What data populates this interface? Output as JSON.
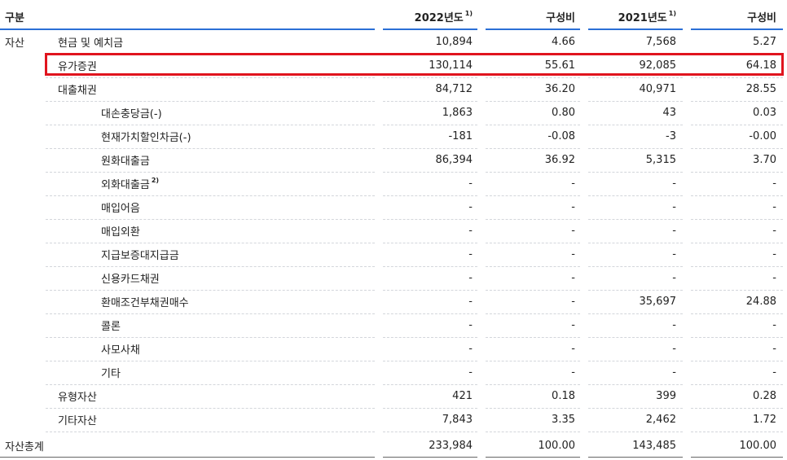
{
  "header": {
    "category": "구분",
    "y2022": "2022년도",
    "y2022_sup": "1)",
    "ratio1": "구성비",
    "y2021": "2021년도",
    "y2021_sup": "1)",
    "ratio2": "구성비"
  },
  "asset_category": "자산",
  "rows": [
    {
      "label": "현금 및 예치금",
      "sup": "",
      "v2022": "10,894",
      "r2022": "4.66",
      "v2021": "7,568",
      "r2021": "5.27"
    },
    {
      "label": "유가증권",
      "sup": "",
      "v2022": "130,114",
      "r2022": "55.61",
      "v2021": "92,085",
      "r2021": "64.18"
    },
    {
      "label": "대출채권",
      "sup": "",
      "v2022": "84,712",
      "r2022": "36.20",
      "v2021": "40,971",
      "r2021": "28.55"
    },
    {
      "label": "대손충당금(-)",
      "sup": "",
      "v2022": "1,863",
      "r2022": "0.80",
      "v2021": "43",
      "r2021": "0.03"
    },
    {
      "label": "현재가치할인차금(-)",
      "sup": "",
      "v2022": "-181",
      "r2022": "-0.08",
      "v2021": "-3",
      "r2021": "-0.00"
    },
    {
      "label": "원화대출금",
      "sup": "",
      "v2022": "86,394",
      "r2022": "36.92",
      "v2021": "5,315",
      "r2021": "3.70"
    },
    {
      "label": "외화대출금",
      "sup": "2)",
      "v2022": "-",
      "r2022": "-",
      "v2021": "-",
      "r2021": "-"
    },
    {
      "label": "매입어음",
      "sup": "",
      "v2022": "-",
      "r2022": "-",
      "v2021": "-",
      "r2021": "-"
    },
    {
      "label": "매입외환",
      "sup": "",
      "v2022": "-",
      "r2022": "-",
      "v2021": "-",
      "r2021": "-"
    },
    {
      "label": "지급보증대지급금",
      "sup": "",
      "v2022": "-",
      "r2022": "-",
      "v2021": "-",
      "r2021": "-"
    },
    {
      "label": "신용카드채권",
      "sup": "",
      "v2022": "-",
      "r2022": "-",
      "v2021": "-",
      "r2021": "-"
    },
    {
      "label": "환매조건부채권매수",
      "sup": "",
      "v2022": "-",
      "r2022": "-",
      "v2021": "35,697",
      "r2021": "24.88"
    },
    {
      "label": "콜론",
      "sup": "",
      "v2022": "-",
      "r2022": "-",
      "v2021": "-",
      "r2021": "-"
    },
    {
      "label": "사모사채",
      "sup": "",
      "v2022": "-",
      "r2022": "-",
      "v2021": "-",
      "r2021": "-"
    },
    {
      "label": "기타",
      "sup": "",
      "v2022": "-",
      "r2022": "-",
      "v2021": "-",
      "r2021": "-"
    },
    {
      "label": "유형자산",
      "sup": "",
      "v2022": "421",
      "r2022": "0.18",
      "v2021": "399",
      "r2021": "0.28"
    },
    {
      "label": "기타자산",
      "sup": "",
      "v2022": "7,843",
      "r2022": "3.35",
      "v2021": "2,462",
      "r2021": "1.72"
    }
  ],
  "total": {
    "label": "자산총계",
    "v2022": "233,984",
    "r2022": "100.00",
    "v2021": "143,485",
    "r2021": "100.00"
  },
  "colors": {
    "header_line": "#2b6fd6",
    "highlight": "#e0141e"
  }
}
